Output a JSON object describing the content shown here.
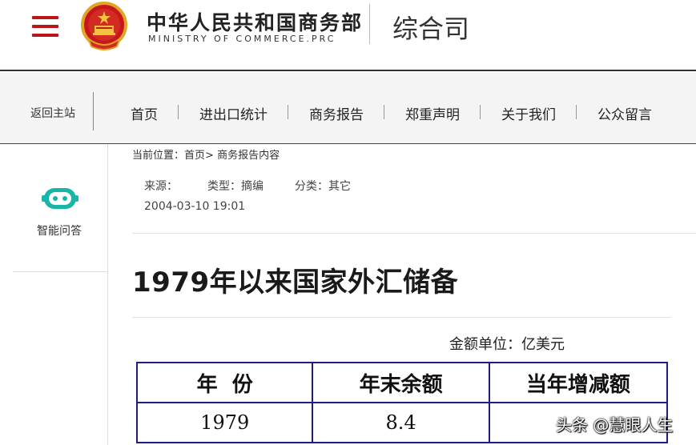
{
  "header": {
    "ministry_cn": "中华人民共和国商务部",
    "ministry_en": "MINISTRY OF COMMERCE.PRC",
    "department": "综合司",
    "menu_icon": "hamburger-menu-icon",
    "emblem_icon": "national-emblem-icon",
    "brand_color": "#b8161b"
  },
  "nav": {
    "back_home": "返回主站",
    "items": [
      {
        "label": "首页"
      },
      {
        "label": "进出口统计"
      },
      {
        "label": "商务报告"
      },
      {
        "label": "郑重声明"
      },
      {
        "label": "关于我们"
      },
      {
        "label": "公众留言"
      }
    ]
  },
  "sidebar": {
    "assistant_label": "智能问答",
    "assistant_icon": "robot-chat-icon",
    "accent_color": "#17b6a6"
  },
  "breadcrumb": {
    "prefix": "当前位置：",
    "home": "首页",
    "separator": ">",
    "current": "商务报告内容"
  },
  "article": {
    "source": "来源：",
    "type": "类型：摘编",
    "category": "分类：其它",
    "timestamp": "2004-03-10 19:01",
    "title": "1979年以来国家外汇储备",
    "unit_note": "金额单位：亿美元"
  },
  "table": {
    "headers": [
      "年  份",
      "年末余额",
      "当年增减额"
    ],
    "rows": [
      [
        "1979",
        "8.4",
        ""
      ]
    ],
    "border_color": "#1f1d85"
  },
  "watermark": {
    "text": "头条 @慧眼人生"
  }
}
